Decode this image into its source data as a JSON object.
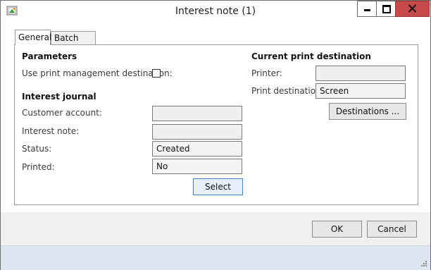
{
  "window": {
    "title": "Interest note (1)"
  },
  "tabs": [
    {
      "label": "General",
      "active": true
    },
    {
      "label": "Batch",
      "active": false
    }
  ],
  "parameters": {
    "title": "Parameters",
    "use_print_mgmt_label": "Use print management destination:",
    "use_print_mgmt_checked": false
  },
  "interest_journal": {
    "title": "Interest journal",
    "customer_account_label": "Customer account:",
    "customer_account_value": "",
    "interest_note_label": "Interest note:",
    "interest_note_value": "",
    "status_label": "Status:",
    "status_value": "Created",
    "printed_label": "Printed:",
    "printed_value": "No",
    "select_button": "Select"
  },
  "print_destination": {
    "title": "Current print destination",
    "printer_label": "Printer:",
    "printer_value": "",
    "destination_label": "Print destination:",
    "destination_value": "Screen",
    "destinations_button": "Destinations ..."
  },
  "footer": {
    "ok_button": "OK",
    "cancel_button": "Cancel"
  },
  "colors": {
    "close_button": "#c74a4a",
    "status_bar": "#dde6f0",
    "footer": "#f0f0f0"
  },
  "icons": [
    "app-icon",
    "minimize-icon",
    "maximize-icon",
    "close-icon",
    "resize-grip-icon"
  ]
}
